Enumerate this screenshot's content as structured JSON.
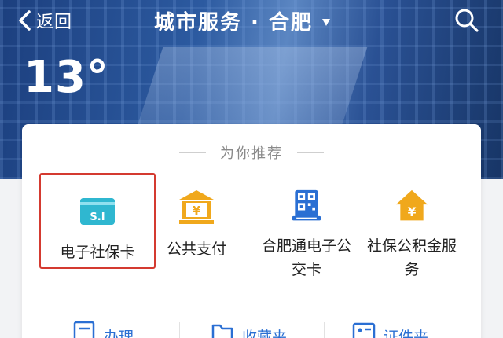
{
  "header": {
    "back_label": "返回",
    "title": "城市服务 · 合肥",
    "back_icon": "chevron-left-icon",
    "dropdown_icon": "caret-down-icon",
    "search_icon": "search-icon"
  },
  "weather": {
    "temperature": "13°"
  },
  "recommend": {
    "title": "为你推荐",
    "items": [
      {
        "label": "电子社保卡",
        "icon": "social-security-card-icon",
        "icon_text": "S.I",
        "selected": true
      },
      {
        "label": "公共支付",
        "icon": "bank-yuan-icon",
        "icon_text": "¥"
      },
      {
        "label": "合肥通电子公交卡",
        "icon": "qr-code-card-icon"
      },
      {
        "label": "社保公积金服务",
        "icon": "house-yuan-icon",
        "icon_text": "¥"
      }
    ]
  },
  "toolbar": {
    "items": [
      {
        "label": "办理",
        "icon": "document-icon"
      },
      {
        "label": "收藏夹",
        "icon": "folder-icon"
      },
      {
        "label": "证件夹",
        "icon": "id-card-icon"
      }
    ]
  },
  "colors": {
    "accent_blue": "#2a6fd3",
    "highlight_red": "#d43a30",
    "gold": "#f0a81c",
    "teal": "#2fb7d0"
  }
}
